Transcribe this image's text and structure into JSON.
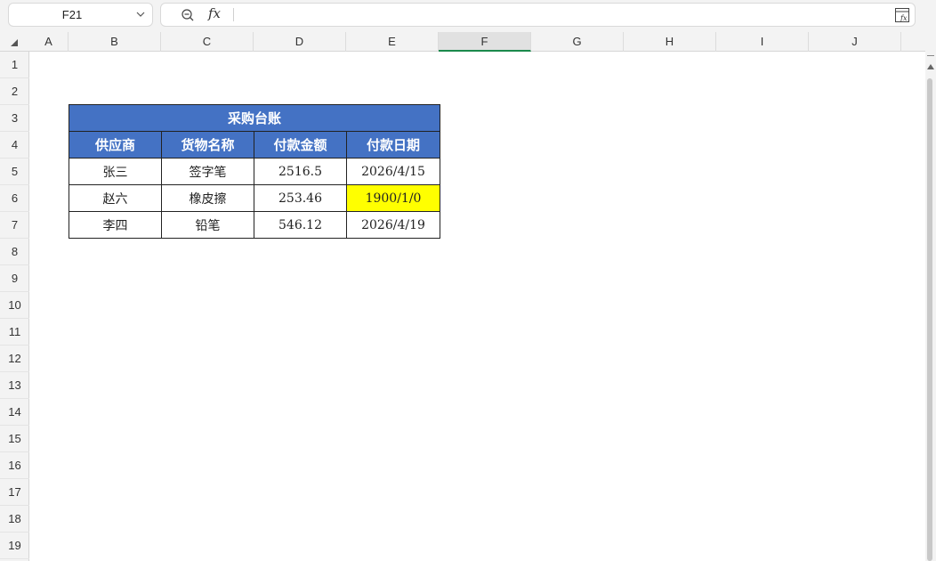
{
  "formula_bar": {
    "name_box": "F21",
    "zoom_icon": "zoom-icon",
    "fx_label": "fx",
    "formula_value": "",
    "fx_button_icon": "insert-function-icon"
  },
  "columns": [
    "A",
    "B",
    "C",
    "D",
    "E",
    "F",
    "G",
    "H",
    "I",
    "J"
  ],
  "selected_column": "F",
  "rows": [
    "1",
    "2",
    "3",
    "4",
    "5",
    "6",
    "7",
    "8",
    "9",
    "10",
    "11",
    "12",
    "13",
    "14",
    "15",
    "16",
    "17",
    "18",
    "19"
  ],
  "table": {
    "title": "采购台账",
    "headers": [
      "供应商",
      "货物名称",
      "付款金额",
      "付款日期"
    ],
    "rows": [
      [
        "张三",
        "签字笔",
        "2516.5",
        "2026/4/15"
      ],
      [
        "赵六",
        "橡皮擦",
        "253.46",
        "1900/1/0"
      ],
      [
        "李四",
        "铅笔",
        "546.12",
        "2026/4/19"
      ]
    ],
    "header_fill": "#4472c4",
    "highlight_fill": "#ffff00"
  }
}
